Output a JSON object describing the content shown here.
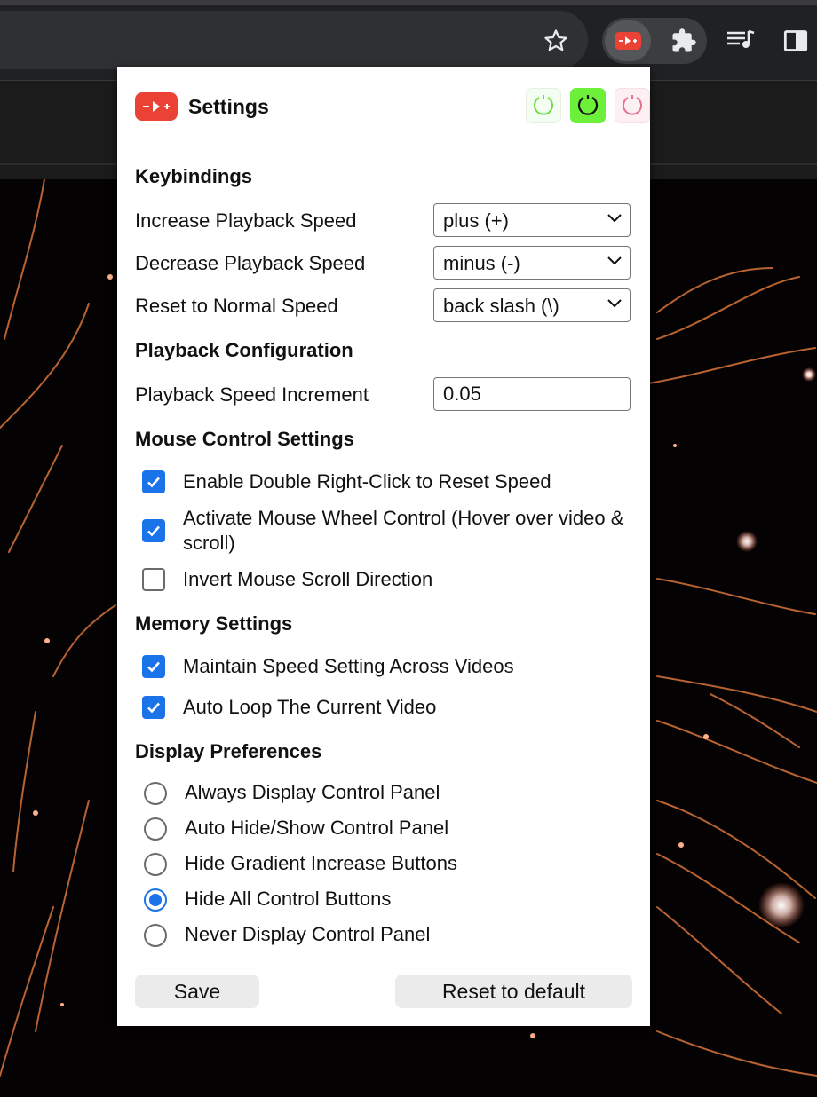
{
  "popup": {
    "title": "Settings",
    "logo_icon": "speed-controller-logo-icon",
    "themes": [
      {
        "name": "light-theme",
        "color": "#7ed957"
      },
      {
        "name": "dark-green-theme",
        "color": "#76f546"
      },
      {
        "name": "pink-theme",
        "color": "#e8708f"
      }
    ]
  },
  "keybindings": {
    "title": "Keybindings",
    "rows": [
      {
        "label": "Increase Playback Speed",
        "value": "plus (+)"
      },
      {
        "label": "Decrease Playback Speed",
        "value": "minus (-)"
      },
      {
        "label": "Reset to Normal Speed",
        "value": "back slash (\\)"
      }
    ]
  },
  "playback": {
    "title": "Playback Configuration",
    "increment_label": "Playback Speed Increment",
    "increment_value": "0.05"
  },
  "mouse": {
    "title": "Mouse Control Settings",
    "options": [
      {
        "label": "Enable Double Right-Click to Reset Speed",
        "checked": true
      },
      {
        "label": "Activate Mouse Wheel Control (Hover over video & scroll)",
        "checked": true
      },
      {
        "label": "Invert Mouse Scroll Direction",
        "checked": false
      }
    ]
  },
  "memory": {
    "title": "Memory Settings",
    "options": [
      {
        "label": "Maintain Speed Setting Across Videos",
        "checked": true
      },
      {
        "label": "Auto Loop The Current Video",
        "checked": true
      }
    ]
  },
  "display": {
    "title": "Display Preferences",
    "options": [
      {
        "label": "Always Display Control Panel",
        "selected": false
      },
      {
        "label": "Auto Hide/Show Control Panel",
        "selected": false
      },
      {
        "label": "Hide Gradient Increase Buttons",
        "selected": false
      },
      {
        "label": "Hide All Control Buttons",
        "selected": true
      },
      {
        "label": "Never Display Control Panel",
        "selected": false
      }
    ]
  },
  "buttons": {
    "save_label": "Save",
    "reset_label": "Reset to default"
  },
  "colors": {
    "accent": "#1a73e8",
    "logo": "#ea4335",
    "chrome_bg": "#202124"
  }
}
